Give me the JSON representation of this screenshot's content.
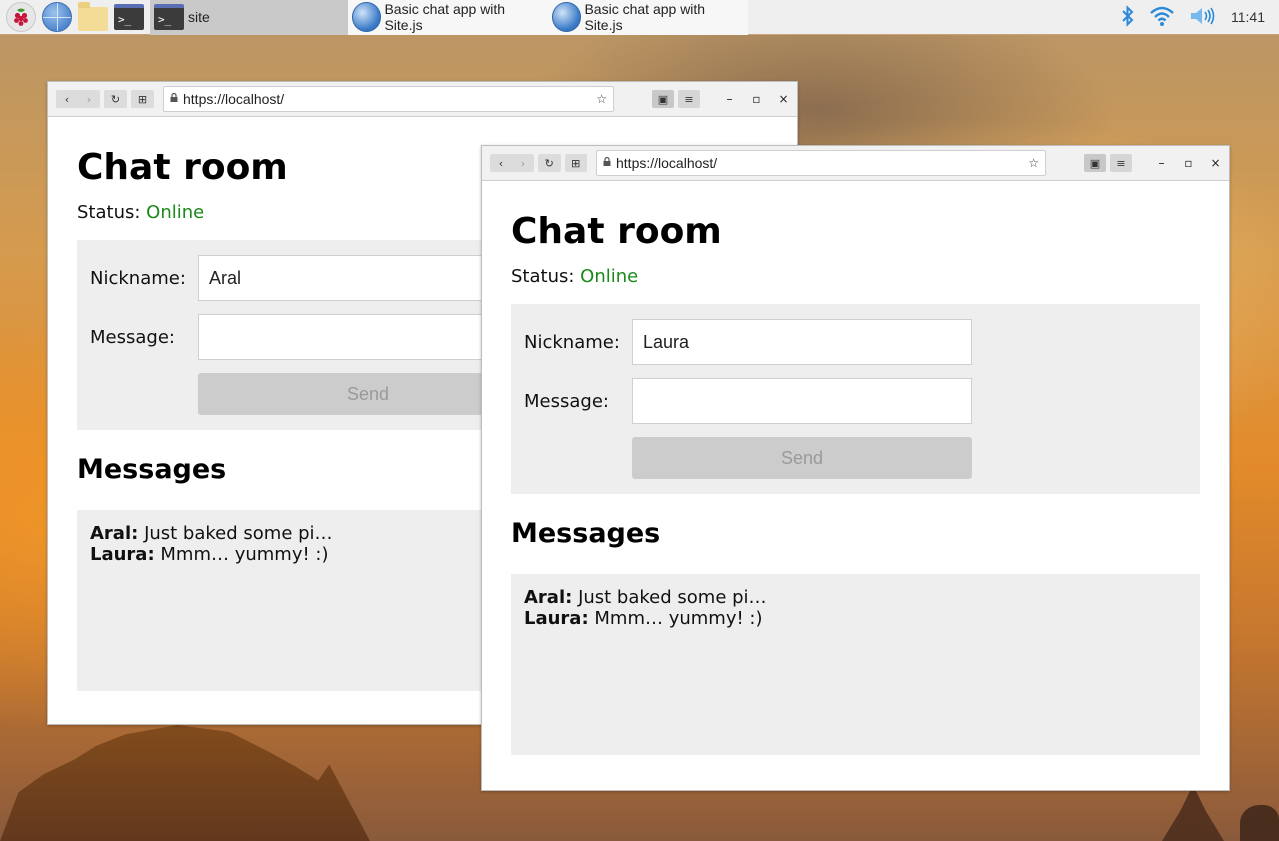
{
  "taskbar": {
    "launchers": [
      {
        "name": "raspberry-pi-menu",
        "icon": "raspberry-pi-icon"
      },
      {
        "name": "web-browser",
        "icon": "globe-icon"
      },
      {
        "name": "file-manager",
        "icon": "folder-icon"
      },
      {
        "name": "terminal",
        "icon": "terminal-icon",
        "glyph": ">_"
      }
    ],
    "tasks": [
      {
        "label": "site",
        "icon": "terminal-icon",
        "glyph": ">_",
        "active": true
      },
      {
        "label": "Basic chat app with Site.js",
        "icon": "browser-globe-icon",
        "active": false
      },
      {
        "label": "Basic chat app with Site.js",
        "icon": "browser-globe-icon",
        "active": false
      }
    ],
    "tray": {
      "bluetooth_glyph": "✱",
      "wifi_glyph": "◠",
      "volume_glyph": "🔈",
      "clock": "11:41"
    }
  },
  "windows": [
    {
      "chrome": {
        "back_glyph": "‹",
        "forward_glyph": "›",
        "reload_glyph": "↻",
        "new_tab_glyph": "⊞",
        "lock_glyph": "🔒",
        "url": "https://localhost/",
        "star_glyph": "☆",
        "bookmarks_glyph": "▣",
        "menu_glyph": "≡",
        "minimize_glyph": "–",
        "maximize_glyph": "▫",
        "close_glyph": "×"
      },
      "page": {
        "title": "Chat room",
        "status_label": "Status:",
        "status_value": "Online",
        "nickname_label": "Nickname:",
        "nickname_value": "Aral",
        "message_label": "Message:",
        "message_value": "",
        "send_label": "Send",
        "messages_heading": "Messages",
        "messages": [
          {
            "author": "Aral:",
            "text": "Just baked some pi…"
          },
          {
            "author": "Laura:",
            "text": "Mmm… yummy! :)"
          }
        ]
      }
    },
    {
      "chrome": {
        "back_glyph": "‹",
        "forward_glyph": "›",
        "reload_glyph": "↻",
        "new_tab_glyph": "⊞",
        "lock_glyph": "🔒",
        "url": "https://localhost/",
        "star_glyph": "☆",
        "bookmarks_glyph": "▣",
        "menu_glyph": "≡",
        "minimize_glyph": "–",
        "maximize_glyph": "▫",
        "close_glyph": "×"
      },
      "page": {
        "title": "Chat room",
        "status_label": "Status:",
        "status_value": "Online",
        "nickname_label": "Nickname:",
        "nickname_value": "Laura",
        "message_label": "Message:",
        "message_value": "",
        "send_label": "Send",
        "messages_heading": "Messages",
        "messages": [
          {
            "author": "Aral:",
            "text": "Just baked some pi…"
          },
          {
            "author": "Laura:",
            "text": "Mmm… yummy! :)"
          }
        ]
      }
    }
  ],
  "colors": {
    "status_online": "#1a8a1a",
    "panel_background": "#eeeeee",
    "send_button_disabled": "#cccccc"
  }
}
